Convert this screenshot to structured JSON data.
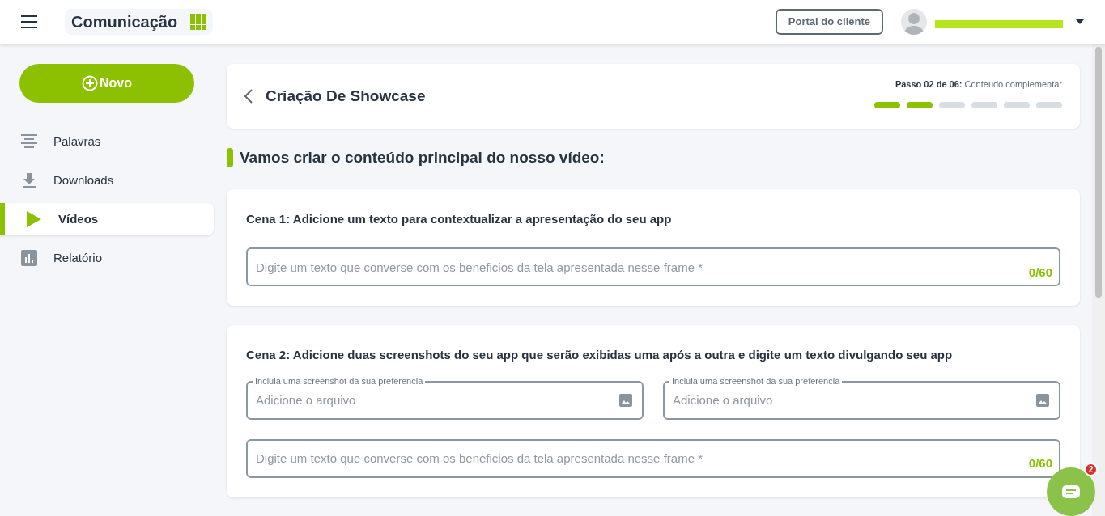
{
  "header": {
    "app_title": "Comunicação",
    "portal_button": "Portal do cliente"
  },
  "sidebar": {
    "new_button": "Novo",
    "items": [
      {
        "label": "Palavras",
        "selected": false
      },
      {
        "label": "Downloads",
        "selected": false
      },
      {
        "label": "Vídeos",
        "selected": true
      },
      {
        "label": "Relatório",
        "selected": false
      }
    ]
  },
  "wizard": {
    "title": "Criação De Showcase",
    "step_label": "Passo 02 de 06:",
    "step_name": "Conteudo complementar",
    "steps": [
      {
        "done": true
      },
      {
        "done": true
      },
      {
        "done": false
      },
      {
        "done": false
      },
      {
        "done": false
      },
      {
        "done": false
      }
    ]
  },
  "section_heading": "Vamos criar o conteúdo principal do nosso vídeo:",
  "scenes": [
    {
      "title": "Cena 1: Adicione um texto para contextualizar a apresentação do seu app",
      "text": {
        "placeholder": "Digite um texto que converse com os beneficios da tela apresentada nesse frame *",
        "counter": "0/60"
      }
    },
    {
      "title": "Cena 2: Adicione duas screenshots do seu app que serão exibidas uma após a outra e digite um texto divulgando seu app",
      "files": [
        {
          "label": "Incluia uma screenshot da sua preferencia",
          "placeholder": "Adicione o arquivo"
        },
        {
          "label": "Incluia uma screenshot da sua preferencia",
          "placeholder": "Adicione o arquivo"
        }
      ],
      "text": {
        "placeholder": "Digite um texto que converse com os beneficios da tela apresentada nesse frame *",
        "counter": "0/60"
      }
    }
  ],
  "chat": {
    "badge": "2"
  }
}
